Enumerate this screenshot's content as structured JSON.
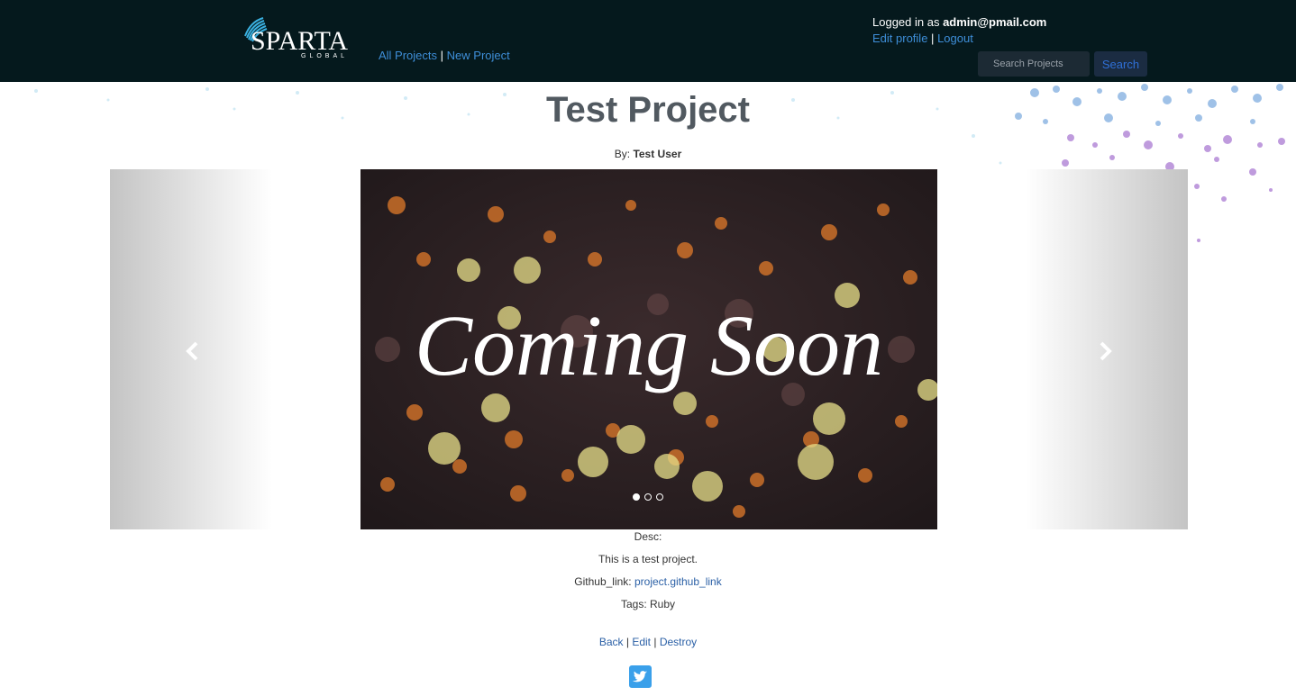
{
  "header": {
    "logo_text": "SPARTA",
    "logo_subtext": "GLOBAL",
    "nav": {
      "all_projects": "All Projects",
      "separator": "|",
      "new_project": "New Project"
    },
    "user": {
      "logged_in_prefix": "Logged in as",
      "email": "admin@pmail.com",
      "edit_profile": "Edit profile",
      "separator": "|",
      "logout": "Logout"
    },
    "search": {
      "placeholder": "Search Projects",
      "button_label": "Search"
    }
  },
  "project": {
    "title": "Test Project",
    "by_label": "By:",
    "author": "Test User",
    "slide_text": "Coming Soon",
    "carousel": {
      "slide_count": 3,
      "active_index": 0
    },
    "desc_label": "Desc:",
    "description": "This is a test project.",
    "github_label": "Github_link:",
    "github_link": "project.github_link",
    "tags_label": "Tags:",
    "tags": "Ruby"
  },
  "actions": {
    "back": "Back",
    "edit": "Edit",
    "destroy": "Destroy",
    "separator": "|"
  },
  "icons": {
    "carousel_prev": "chevron-left-icon",
    "carousel_next": "chevron-right-icon",
    "share": "twitter-icon"
  },
  "colors": {
    "navbar_bg": "#05191d",
    "link": "#3e8ed8",
    "content_link": "#2b60a6",
    "twitter": "#3aa0ea"
  }
}
